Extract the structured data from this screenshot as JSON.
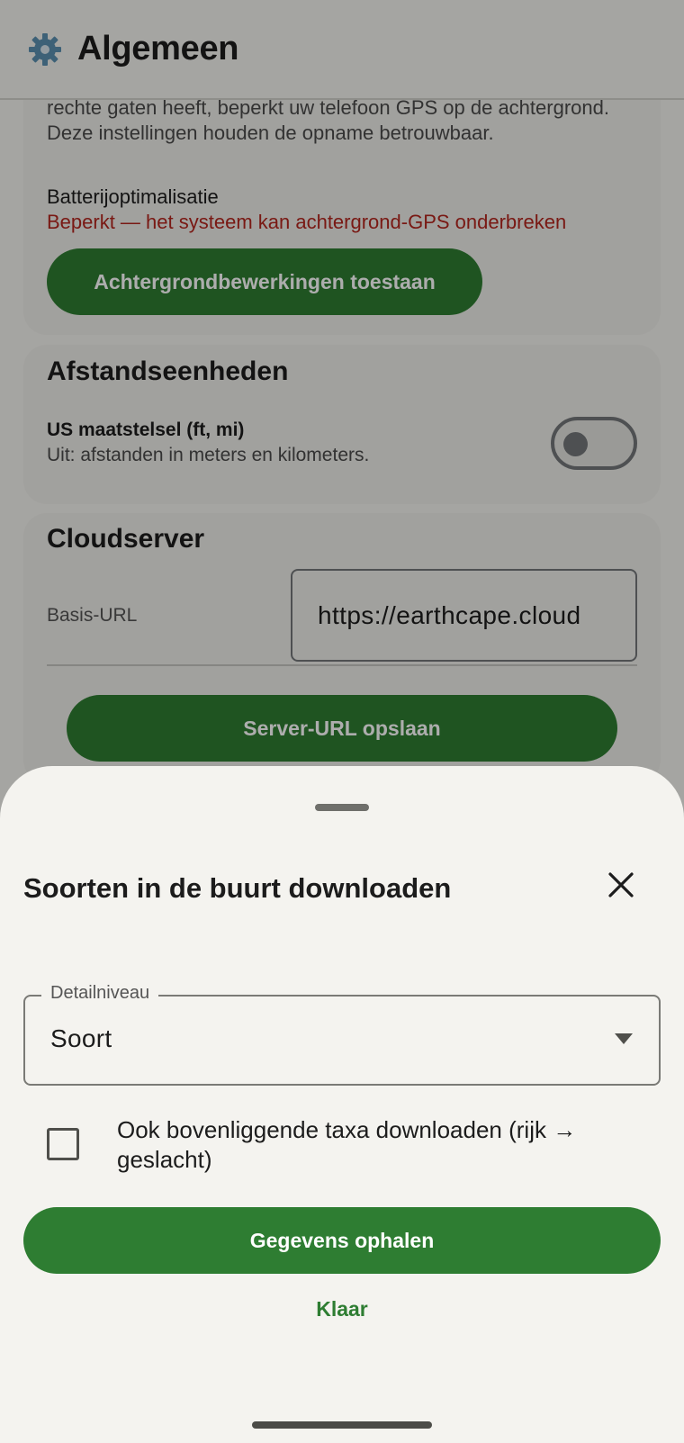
{
  "appbar": {
    "title": "Algemeen",
    "icon": "gear-icon"
  },
  "background_settings": {
    "intro_text": "rechte gaten heeft, beperkt uw telefoon GPS op de achtergrond. Deze instellingen houden de opname betrouwbaar.",
    "battery_label": "Batterijoptimalisatie",
    "battery_status": "Beperkt — het systeem kan achtergrond-GPS onderbreken",
    "background_button_label": "Achtergrondbewerkingen toestaan"
  },
  "distance_units": {
    "section_title": "Afstandseenheden",
    "us_label": "US maatstelsel (ft, mi)",
    "us_subtitle": "Uit: afstanden in meters en kilometers.",
    "us_enabled": false
  },
  "cloud_server": {
    "section_title": "Cloudserver",
    "url_label": "Basis-URL",
    "url_value": "https://earthcape.cloud",
    "save_button_label": "Server-URL opslaan"
  },
  "sheet": {
    "title": "Soorten in de buurt downloaden",
    "dropdown_label": "Detailniveau",
    "dropdown_value": "Soort",
    "checkbox_label": "Ook bovenliggende taxa downloaden (rijk → geslacht)",
    "checkbox_checked": false,
    "fetch_button_label": "Gegevens ophalen",
    "done_button_label": "Klaar"
  },
  "colors": {
    "accent_green": "#2e7d32",
    "warning_red": "#b3261e",
    "surface": "#f4f3ef"
  }
}
